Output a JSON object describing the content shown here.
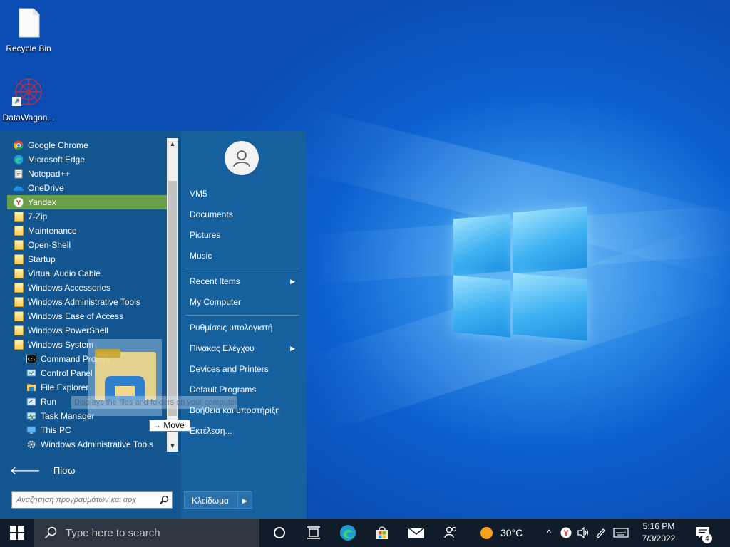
{
  "desktop": {
    "icons": [
      {
        "label": "Recycle Bin",
        "icon": "recycle-bin-icon"
      },
      {
        "label": "DataWagon...",
        "icon": "datawagon-icon"
      }
    ]
  },
  "start_menu": {
    "programs": [
      {
        "label": "Google Chrome",
        "icon": "chrome-icon"
      },
      {
        "label": "Microsoft Edge",
        "icon": "edge-icon"
      },
      {
        "label": "Notepad++",
        "icon": "notepadpp-icon"
      },
      {
        "label": "OneDrive",
        "icon": "onedrive-icon"
      },
      {
        "label": "Yandex",
        "icon": "yandex-icon"
      },
      {
        "label": "7-Zip",
        "icon": "folder-icon"
      },
      {
        "label": "Maintenance",
        "icon": "folder-icon"
      },
      {
        "label": "Open-Shell",
        "icon": "folder-icon"
      },
      {
        "label": "Startup",
        "icon": "folder-icon"
      },
      {
        "label": "Virtual Audio Cable",
        "icon": "folder-icon"
      },
      {
        "label": "Windows Accessories",
        "icon": "folder-icon"
      },
      {
        "label": "Windows Administrative Tools",
        "icon": "folder-icon"
      },
      {
        "label": "Windows Ease of Access",
        "icon": "folder-icon"
      },
      {
        "label": "Windows PowerShell",
        "icon": "folder-icon"
      },
      {
        "label": "Windows System",
        "icon": "folder-icon"
      },
      {
        "label": "Command Prompt",
        "icon": "cmd-icon"
      },
      {
        "label": "Control Panel",
        "icon": "control-panel-icon"
      },
      {
        "label": "File Explorer",
        "icon": "file-explorer-icon"
      },
      {
        "label": "Run",
        "icon": "run-icon"
      },
      {
        "label": "Task Manager",
        "icon": "task-manager-icon"
      },
      {
        "label": "This PC",
        "icon": "this-pc-icon"
      },
      {
        "label": "Windows Administrative Tools",
        "icon": "admin-tools-icon"
      }
    ],
    "selected": "Yandex",
    "back_label": "Πίσω",
    "search_placeholder": "Αναζήτηση προγραμμάτων και αρχ",
    "right": {
      "user_items": [
        "VM5",
        "Documents",
        "Pictures",
        "Music"
      ],
      "recent_items": "Recent Items",
      "my_computer": "My Computer",
      "settings": "Ρυθμίσεις υπολογιστή",
      "control_panel": "Πίνακας Ελέγχου",
      "devices": "Devices and Printers",
      "default_programs": "Default Programs",
      "help": "Βοήθεια και υποστήριξη",
      "run": "Εκτέλεση...",
      "lock": "Κλείδωμα"
    }
  },
  "drag": {
    "tooltip": "Displays the files and folders on your computer",
    "action": "Move"
  },
  "taskbar": {
    "search_placeholder": "Type here to search",
    "weather_temp": "30°C",
    "time": "5:16 PM",
    "date": "7/3/2022",
    "notification_count": "4"
  },
  "colors": {
    "start_bg": "#17609e",
    "selection": "#6ba04a",
    "taskbar": "#111c2b"
  }
}
